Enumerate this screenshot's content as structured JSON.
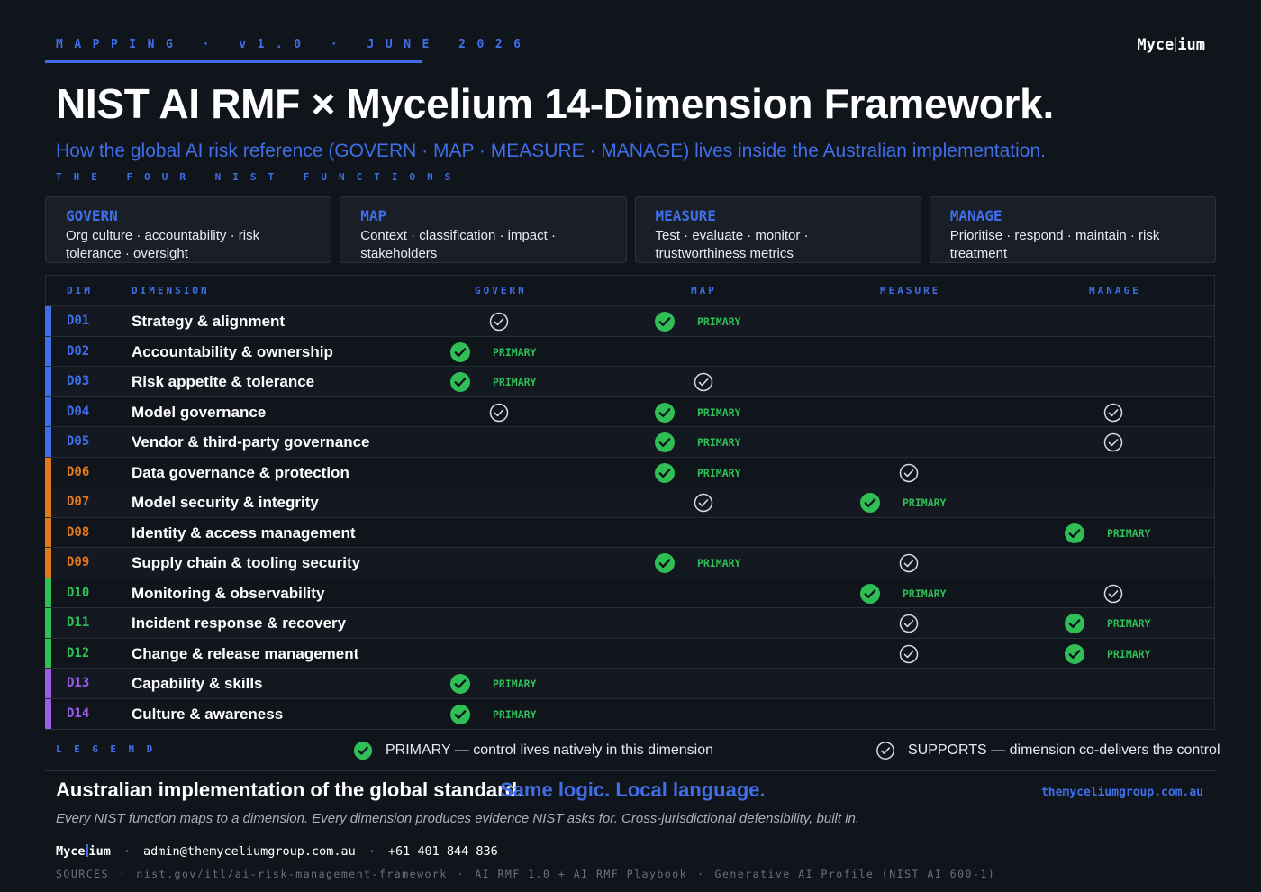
{
  "header": {
    "kicker": "MAPPING · v1.0 · JUNE 2026",
    "logo_left": "Myce",
    "logo_right": "ium",
    "title": "NIST AI RMF × Mycelium 14-Dimension Framework.",
    "subtitle": "How the global AI risk reference (GOVERN · MAP · MEASURE · MANAGE) lives inside the Australian implementation.",
    "section_label": "THE FOUR NIST FUNCTIONS"
  },
  "functions": [
    {
      "name": "GOVERN",
      "desc_line1": "Org culture · accountability · risk",
      "desc_line2": "tolerance · oversight"
    },
    {
      "name": "MAP",
      "desc_line1": "Context · classification · impact ·",
      "desc_line2": "stakeholders"
    },
    {
      "name": "MEASURE",
      "desc_line1": "Test · evaluate · monitor ·",
      "desc_line2": "trustworthiness metrics"
    },
    {
      "name": "MANAGE",
      "desc_line1": "Prioritise · respond · maintain · risk",
      "desc_line2": "treatment"
    }
  ],
  "table": {
    "headers": {
      "dim": "DIM",
      "dimension": "DIMENSION",
      "govern": "GOVERN",
      "map": "MAP",
      "measure": "MEASURE",
      "manage": "MANAGE"
    },
    "primary_label": "PRIMARY",
    "rows": [
      {
        "code": "D01",
        "name": "Strategy & alignment",
        "group": "blue",
        "govern": "supports",
        "map": "primary",
        "measure": "",
        "manage": ""
      },
      {
        "code": "D02",
        "name": "Accountability & ownership",
        "group": "blue",
        "govern": "primary",
        "map": "",
        "measure": "",
        "manage": ""
      },
      {
        "code": "D03",
        "name": "Risk appetite & tolerance",
        "group": "blue",
        "govern": "primary",
        "map": "supports",
        "measure": "",
        "manage": ""
      },
      {
        "code": "D04",
        "name": "Model governance",
        "group": "blue",
        "govern": "supports",
        "map": "primary",
        "measure": "",
        "manage": "supports"
      },
      {
        "code": "D05",
        "name": "Vendor & third-party governance",
        "group": "blue",
        "govern": "",
        "map": "primary",
        "measure": "",
        "manage": "supports"
      },
      {
        "code": "D06",
        "name": "Data governance & protection",
        "group": "orange",
        "govern": "",
        "map": "primary",
        "measure": "supports",
        "manage": ""
      },
      {
        "code": "D07",
        "name": "Model security & integrity",
        "group": "orange",
        "govern": "",
        "map": "supports",
        "measure": "primary",
        "manage": ""
      },
      {
        "code": "D08",
        "name": "Identity & access management",
        "group": "orange",
        "govern": "",
        "map": "",
        "measure": "",
        "manage": "primary"
      },
      {
        "code": "D09",
        "name": "Supply chain & tooling security",
        "group": "orange",
        "govern": "",
        "map": "primary",
        "measure": "supports",
        "manage": ""
      },
      {
        "code": "D10",
        "name": "Monitoring & observability",
        "group": "green",
        "govern": "",
        "map": "",
        "measure": "primary",
        "manage": "supports"
      },
      {
        "code": "D11",
        "name": "Incident response & recovery",
        "group": "green",
        "govern": "",
        "map": "",
        "measure": "supports",
        "manage": "primary"
      },
      {
        "code": "D12",
        "name": "Change & release management",
        "group": "green",
        "govern": "",
        "map": "",
        "measure": "supports",
        "manage": "primary"
      },
      {
        "code": "D13",
        "name": "Capability & skills",
        "group": "purple",
        "govern": "primary",
        "map": "",
        "measure": "",
        "manage": ""
      },
      {
        "code": "D14",
        "name": "Culture & awareness",
        "group": "purple",
        "govern": "primary",
        "map": "",
        "measure": "",
        "manage": ""
      }
    ]
  },
  "legend": {
    "label": "LEGEND",
    "primary_text": "PRIMARY — control lives natively in this dimension",
    "supports_text": "SUPPORTS — dimension co-delivers the control"
  },
  "footer": {
    "tagline_strong": "Australian implementation of the global standard.",
    "tagline_accent": "Same logic. Local language.",
    "website": "themyceliumgroup.com.au",
    "tagline_sub": "Every NIST function maps to a dimension. Every dimension produces evidence NIST asks for. Cross-jurisdictional defensibility, built in.",
    "email": "admin@themyceliumgroup.com.au",
    "phone": "+61 401 844 836",
    "sources": [
      "SOURCES",
      "nist.gov/itl/ai-risk-management-framework",
      "AI RMF 1.0 + AI RMF Playbook",
      "Generative AI Profile (NIST AI 600-1)"
    ]
  },
  "colors": {
    "background": "#10141b",
    "accent": "#3f6ee8",
    "primary_green": "#2fbf56",
    "group_blue": "#3f6ee8",
    "group_orange": "#e07a1f",
    "group_green": "#2fbf56",
    "group_purple": "#9b5de5",
    "code_blue": "#3f6ee8",
    "code_orange": "#e07a1f",
    "code_green": "#2fbf56",
    "code_purple": "#9b5de5"
  },
  "icons": {
    "primary": "filled-check-circle-icon",
    "supports": "outline-check-circle-icon"
  }
}
